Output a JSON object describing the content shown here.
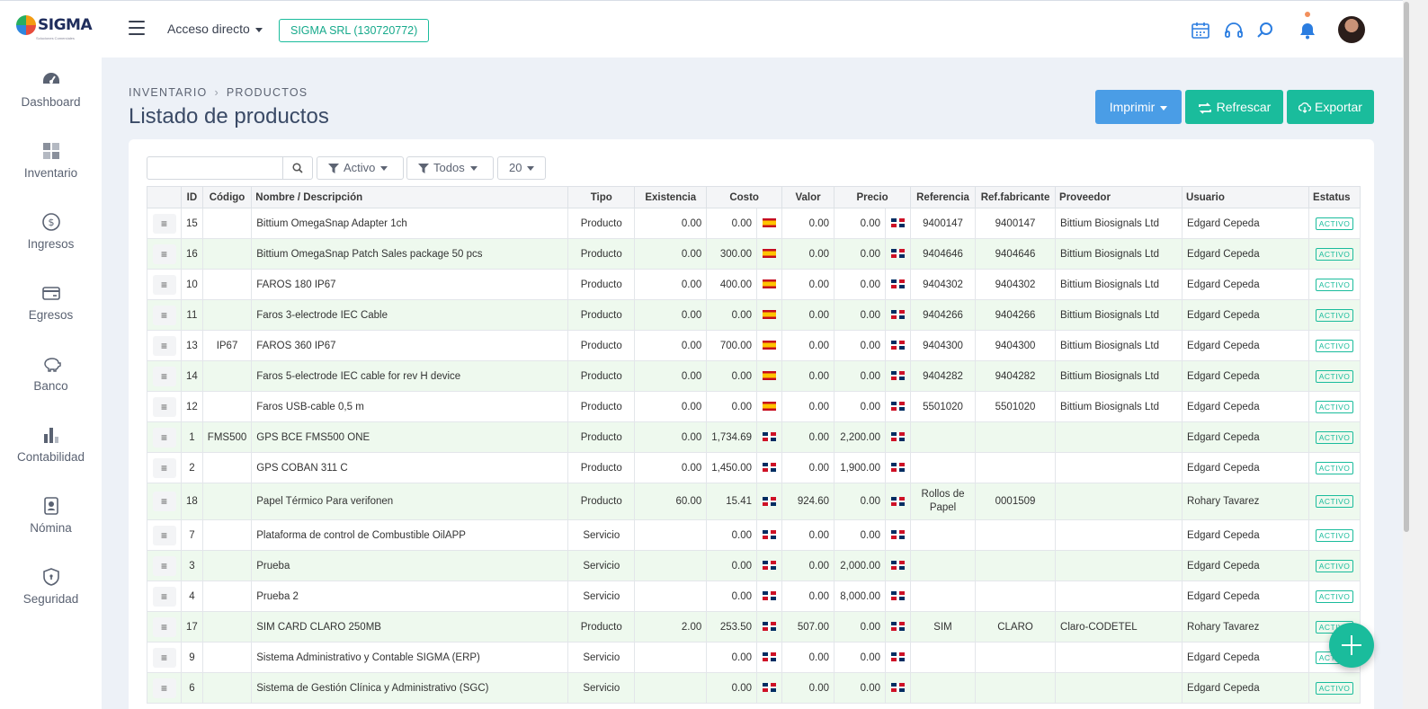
{
  "app": {
    "logo_text": "SIGMA",
    "logo_tagline": "Soluciones Comerciales"
  },
  "header": {
    "quick_access": "Acceso directo",
    "company": "SIGMA SRL (130720772)"
  },
  "sidebar": {
    "items": [
      {
        "label": "Dashboard",
        "icon": "gauge-icon"
      },
      {
        "label": "Inventario",
        "icon": "grid-icon"
      },
      {
        "label": "Ingresos",
        "icon": "dollar-icon"
      },
      {
        "label": "Egresos",
        "icon": "card-icon"
      },
      {
        "label": "Banco",
        "icon": "piggy-bank-icon"
      },
      {
        "label": "Contabilidad",
        "icon": "bar-chart-icon"
      },
      {
        "label": "Nómina",
        "icon": "id-badge-icon"
      },
      {
        "label": "Seguridad",
        "icon": "shield-icon"
      }
    ]
  },
  "breadcrumb": {
    "section": "INVENTARIO",
    "page": "PRODUCTOS"
  },
  "page_title": "Listado de productos",
  "actions": {
    "print": "Imprimir",
    "refresh": "Refrescar",
    "export": "Exportar"
  },
  "filters": {
    "search_value": "",
    "status": "Activo",
    "type": "Todos",
    "page_size": "20"
  },
  "table": {
    "columns": [
      "ID",
      "Código",
      "Nombre / Descripción",
      "Tipo",
      "Existencia",
      "Costo",
      "Valor",
      "Precio",
      "Referencia",
      "Ref.fabricante",
      "Proveedor",
      "Usuario",
      "Estatus"
    ],
    "rows": [
      {
        "id": "15",
        "code": "",
        "name": "Bittium OmegaSnap Adapter 1ch",
        "type": "Producto",
        "stock": "0.00",
        "cost": "0.00",
        "cost_flag": "es",
        "value": "0.00",
        "price": "0.00",
        "price_flag": "do",
        "ref": "9400147",
        "mfr_ref": "9400147",
        "supplier": "Bittium Biosignals Ltd",
        "user": "Edgard Cepeda",
        "status": "ACTIVO"
      },
      {
        "id": "16",
        "code": "",
        "name": "Bittium OmegaSnap Patch Sales package 50 pcs",
        "type": "Producto",
        "stock": "0.00",
        "cost": "300.00",
        "cost_flag": "es",
        "value": "0.00",
        "price": "0.00",
        "price_flag": "do",
        "ref": "9404646",
        "mfr_ref": "9404646",
        "supplier": "Bittium Biosignals Ltd",
        "user": "Edgard Cepeda",
        "status": "ACTIVO"
      },
      {
        "id": "10",
        "code": "",
        "name": "FAROS 180 IP67",
        "type": "Producto",
        "stock": "0.00",
        "cost": "400.00",
        "cost_flag": "es",
        "value": "0.00",
        "price": "0.00",
        "price_flag": "do",
        "ref": "9404302",
        "mfr_ref": "9404302",
        "supplier": "Bittium Biosignals Ltd",
        "user": "Edgard Cepeda",
        "status": "ACTIVO"
      },
      {
        "id": "11",
        "code": "",
        "name": "Faros 3-electrode IEC Cable",
        "type": "Producto",
        "stock": "0.00",
        "cost": "0.00",
        "cost_flag": "es",
        "value": "0.00",
        "price": "0.00",
        "price_flag": "do",
        "ref": "9404266",
        "mfr_ref": "9404266",
        "supplier": "Bittium Biosignals Ltd",
        "user": "Edgard Cepeda",
        "status": "ACTIVO"
      },
      {
        "id": "13",
        "code": "IP67",
        "name": "FAROS 360 IP67",
        "type": "Producto",
        "stock": "0.00",
        "cost": "700.00",
        "cost_flag": "es",
        "value": "0.00",
        "price": "0.00",
        "price_flag": "do",
        "ref": "9404300",
        "mfr_ref": "9404300",
        "supplier": "Bittium Biosignals Ltd",
        "user": "Edgard Cepeda",
        "status": "ACTIVO"
      },
      {
        "id": "14",
        "code": "",
        "name": "Faros 5-electrode IEC cable for rev H device",
        "type": "Producto",
        "stock": "0.00",
        "cost": "0.00",
        "cost_flag": "es",
        "value": "0.00",
        "price": "0.00",
        "price_flag": "do",
        "ref": "9404282",
        "mfr_ref": "9404282",
        "supplier": "Bittium Biosignals Ltd",
        "user": "Edgard Cepeda",
        "status": "ACTIVO"
      },
      {
        "id": "12",
        "code": "",
        "name": "Faros USB-cable 0,5 m",
        "type": "Producto",
        "stock": "0.00",
        "cost": "0.00",
        "cost_flag": "es",
        "value": "0.00",
        "price": "0.00",
        "price_flag": "do",
        "ref": "5501020",
        "mfr_ref": "5501020",
        "supplier": "Bittium Biosignals Ltd",
        "user": "Edgard Cepeda",
        "status": "ACTIVO"
      },
      {
        "id": "1",
        "code": "FMS500",
        "name": "GPS BCE FMS500 ONE",
        "type": "Producto",
        "stock": "0.00",
        "cost": "1,734.69",
        "cost_flag": "do",
        "value": "0.00",
        "price": "2,200.00",
        "price_flag": "do",
        "ref": "",
        "mfr_ref": "",
        "supplier": "",
        "user": "Edgard Cepeda",
        "status": "ACTIVO"
      },
      {
        "id": "2",
        "code": "",
        "name": "GPS COBAN 311 C",
        "type": "Producto",
        "stock": "0.00",
        "cost": "1,450.00",
        "cost_flag": "do",
        "value": "0.00",
        "price": "1,900.00",
        "price_flag": "do",
        "ref": "",
        "mfr_ref": "",
        "supplier": "",
        "user": "Edgard Cepeda",
        "status": "ACTIVO"
      },
      {
        "id": "18",
        "code": "",
        "name": "Papel Térmico Para verifonen",
        "type": "Producto",
        "stock": "60.00",
        "cost": "15.41",
        "cost_flag": "do",
        "value": "924.60",
        "price": "0.00",
        "price_flag": "do",
        "ref": "Rollos de Papel",
        "mfr_ref": "0001509",
        "supplier": "",
        "user": "Rohary Tavarez",
        "status": "ACTIVO"
      },
      {
        "id": "7",
        "code": "",
        "name": "Plataforma de control de Combustible OilAPP",
        "type": "Servicio",
        "stock": "",
        "cost": "0.00",
        "cost_flag": "do",
        "value": "0.00",
        "price": "0.00",
        "price_flag": "do",
        "ref": "",
        "mfr_ref": "",
        "supplier": "",
        "user": "Edgard Cepeda",
        "status": "ACTIVO"
      },
      {
        "id": "3",
        "code": "",
        "name": "Prueba",
        "type": "Servicio",
        "stock": "",
        "cost": "0.00",
        "cost_flag": "do",
        "value": "0.00",
        "price": "2,000.00",
        "price_flag": "do",
        "ref": "",
        "mfr_ref": "",
        "supplier": "",
        "user": "Edgard Cepeda",
        "status": "ACTIVO"
      },
      {
        "id": "4",
        "code": "",
        "name": "Prueba 2",
        "type": "Servicio",
        "stock": "",
        "cost": "0.00",
        "cost_flag": "do",
        "value": "0.00",
        "price": "8,000.00",
        "price_flag": "do",
        "ref": "",
        "mfr_ref": "",
        "supplier": "",
        "user": "Edgard Cepeda",
        "status": "ACTIVO"
      },
      {
        "id": "17",
        "code": "",
        "name": "SIM CARD CLARO 250MB",
        "type": "Producto",
        "stock": "2.00",
        "cost": "253.50",
        "cost_flag": "do",
        "value": "507.00",
        "price": "0.00",
        "price_flag": "do",
        "ref": "SIM",
        "mfr_ref": "CLARO",
        "supplier": "Claro-CODETEL",
        "user": "Rohary Tavarez",
        "status": "ACTIVO"
      },
      {
        "id": "9",
        "code": "",
        "name": "Sistema Administrativo y Contable SIGMA (ERP)",
        "type": "Servicio",
        "stock": "",
        "cost": "0.00",
        "cost_flag": "do",
        "value": "0.00",
        "price": "0.00",
        "price_flag": "do",
        "ref": "",
        "mfr_ref": "",
        "supplier": "",
        "user": "Edgard Cepeda",
        "status": "ACTIVO"
      },
      {
        "id": "6",
        "code": "",
        "name": "Sistema de Gestión Clínica y Administrativo (SGC)",
        "type": "Servicio",
        "stock": "",
        "cost": "0.00",
        "cost_flag": "do",
        "value": "0.00",
        "price": "0.00",
        "price_flag": "do",
        "ref": "",
        "mfr_ref": "",
        "supplier": "",
        "user": "Edgard Cepeda",
        "status": "ACTIVO"
      }
    ]
  },
  "colors": {
    "accent": "#1abc9c",
    "primary": "#4a9de6",
    "row_alt": "#eef9ee",
    "background": "#edf1f7"
  }
}
